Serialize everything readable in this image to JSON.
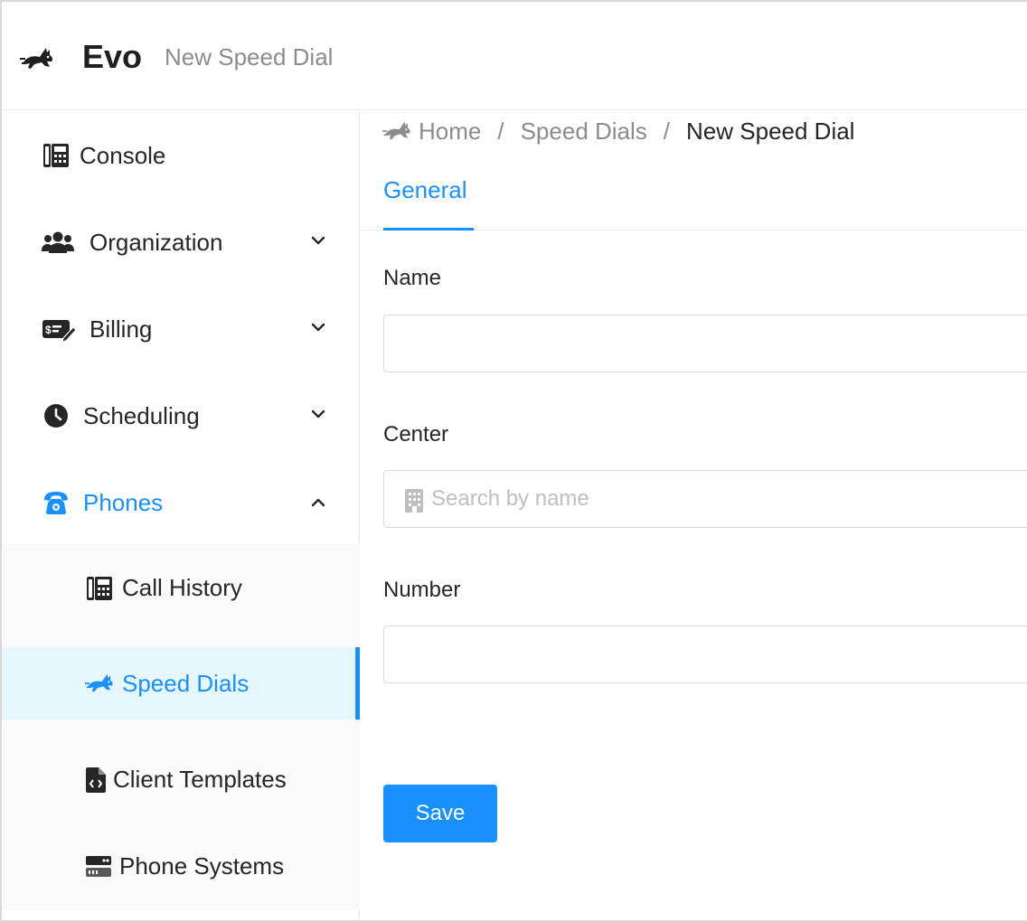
{
  "app": {
    "brand": "Evo",
    "page_title": "New Speed Dial",
    "logo_icon": "rabbit-icon"
  },
  "sidebar": {
    "items": [
      {
        "label": "Console",
        "icon": "phone-office-icon"
      },
      {
        "label": "Organization",
        "icon": "users-icon",
        "expanded": false
      },
      {
        "label": "Billing",
        "icon": "money-check-edit-icon",
        "expanded": false
      },
      {
        "label": "Scheduling",
        "icon": "clock-icon",
        "expanded": false
      },
      {
        "label": "Phones",
        "icon": "phone-rotary-icon",
        "expanded": true,
        "active": true
      }
    ],
    "phones_submenu": [
      {
        "label": "Call History",
        "icon": "phone-office-icon"
      },
      {
        "label": "Speed Dials",
        "icon": "rabbit-running-icon",
        "selected": true
      },
      {
        "label": "Client Templates",
        "icon": "file-code-icon"
      },
      {
        "label": "Phone Systems",
        "icon": "server-icon"
      }
    ]
  },
  "breadcrumb": {
    "items": [
      "Home",
      "Speed Dials",
      "New Speed Dial"
    ]
  },
  "tabs": [
    {
      "label": "General",
      "active": true
    }
  ],
  "form": {
    "name": {
      "label": "Name",
      "value": "",
      "placeholder": ""
    },
    "center": {
      "label": "Center",
      "value": "",
      "placeholder": "Search by name",
      "icon": "building-icon"
    },
    "number": {
      "label": "Number",
      "value": "",
      "placeholder": ""
    },
    "save_label": "Save"
  },
  "colors": {
    "accent": "#1890ff",
    "selected_bg": "#e6f7ff",
    "submenu_bg": "#fafafa"
  }
}
